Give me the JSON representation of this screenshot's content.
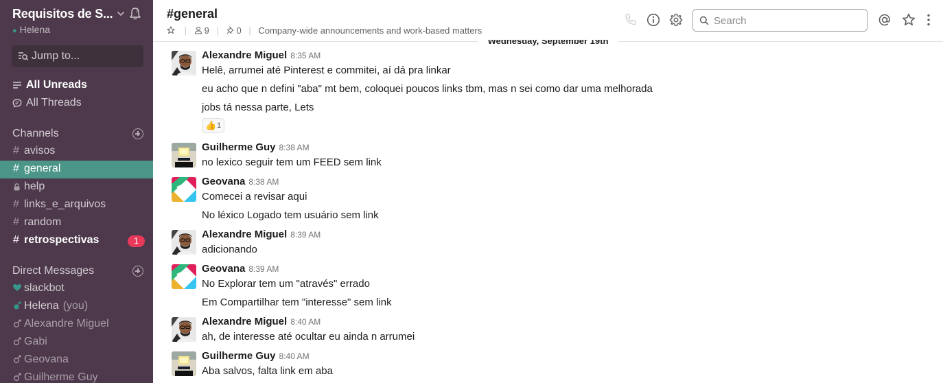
{
  "workspace": {
    "name": "Requisitos de S...",
    "user": "Helena"
  },
  "jump": {
    "label": "Jump to..."
  },
  "nav": {
    "all_unreads": "All Unreads",
    "all_threads": "All Threads"
  },
  "channels": {
    "title": "Channels",
    "items": [
      {
        "name": "avisos",
        "prefix": "#"
      },
      {
        "name": "general",
        "prefix": "#"
      },
      {
        "name": "help",
        "prefix": "lock"
      },
      {
        "name": "links_e_arquivos",
        "prefix": "#"
      },
      {
        "name": "random",
        "prefix": "#"
      },
      {
        "name": "retrospectivas",
        "prefix": "#",
        "badge": "1"
      }
    ]
  },
  "dms": {
    "title": "Direct Messages",
    "items": [
      {
        "name": "slackbot"
      },
      {
        "name": "Helena",
        "suffix": "(you)"
      },
      {
        "name": "Alexandre Miguel"
      },
      {
        "name": "Gabi"
      },
      {
        "name": "Geovana"
      },
      {
        "name": "Guilherme Guy"
      }
    ]
  },
  "header": {
    "channel": "#general",
    "members": "9",
    "pins": "0",
    "topic": "Company-wide announcements and work-based matters",
    "search_placeholder": "Search"
  },
  "date_divider": "Wednesday, September 19th",
  "messages": [
    {
      "author": "Alexandre Miguel",
      "time": "8:35 AM",
      "lines": [
        "Helê, arrumei até Pinterest e commitei, aí dá pra linkar",
        "eu acho que n defini \"aba\" mt bem, coloquei poucos links tbm, mas n sei como dar uma melhorada",
        "jobs tá nessa parte, Lets"
      ],
      "reaction": {
        "emoji": "👍",
        "count": "1"
      }
    },
    {
      "author": "Guilherme Guy",
      "time": "8:38 AM",
      "lines": [
        "no lexico seguir tem um FEED sem link"
      ]
    },
    {
      "author": "Geovana",
      "time": "8:38 AM",
      "lines": [
        "Comecei a revisar aqui",
        "No léxico Logado tem usuário sem link"
      ]
    },
    {
      "author": "Alexandre Miguel",
      "time": "8:39 AM",
      "lines": [
        "adicionando"
      ]
    },
    {
      "author": "Geovana",
      "time": "8:39 AM",
      "lines": [
        "No Explorar tem um \"através\" errado",
        "Em Compartilhar tem \"interesse\" sem link"
      ]
    },
    {
      "author": "Alexandre Miguel",
      "time": "8:40 AM",
      "lines": [
        "ah, de interesse até ocultar eu ainda n arrumei"
      ]
    },
    {
      "author": "Guilherme Guy",
      "time": "8:40 AM",
      "lines": [
        "Aba salvos, falta link em aba"
      ]
    }
  ],
  "colors": {
    "sidebar_bg": "#4d394b",
    "active_channel": "#4c9689",
    "badge": "#e8395b",
    "presence_online": "#38978d"
  }
}
